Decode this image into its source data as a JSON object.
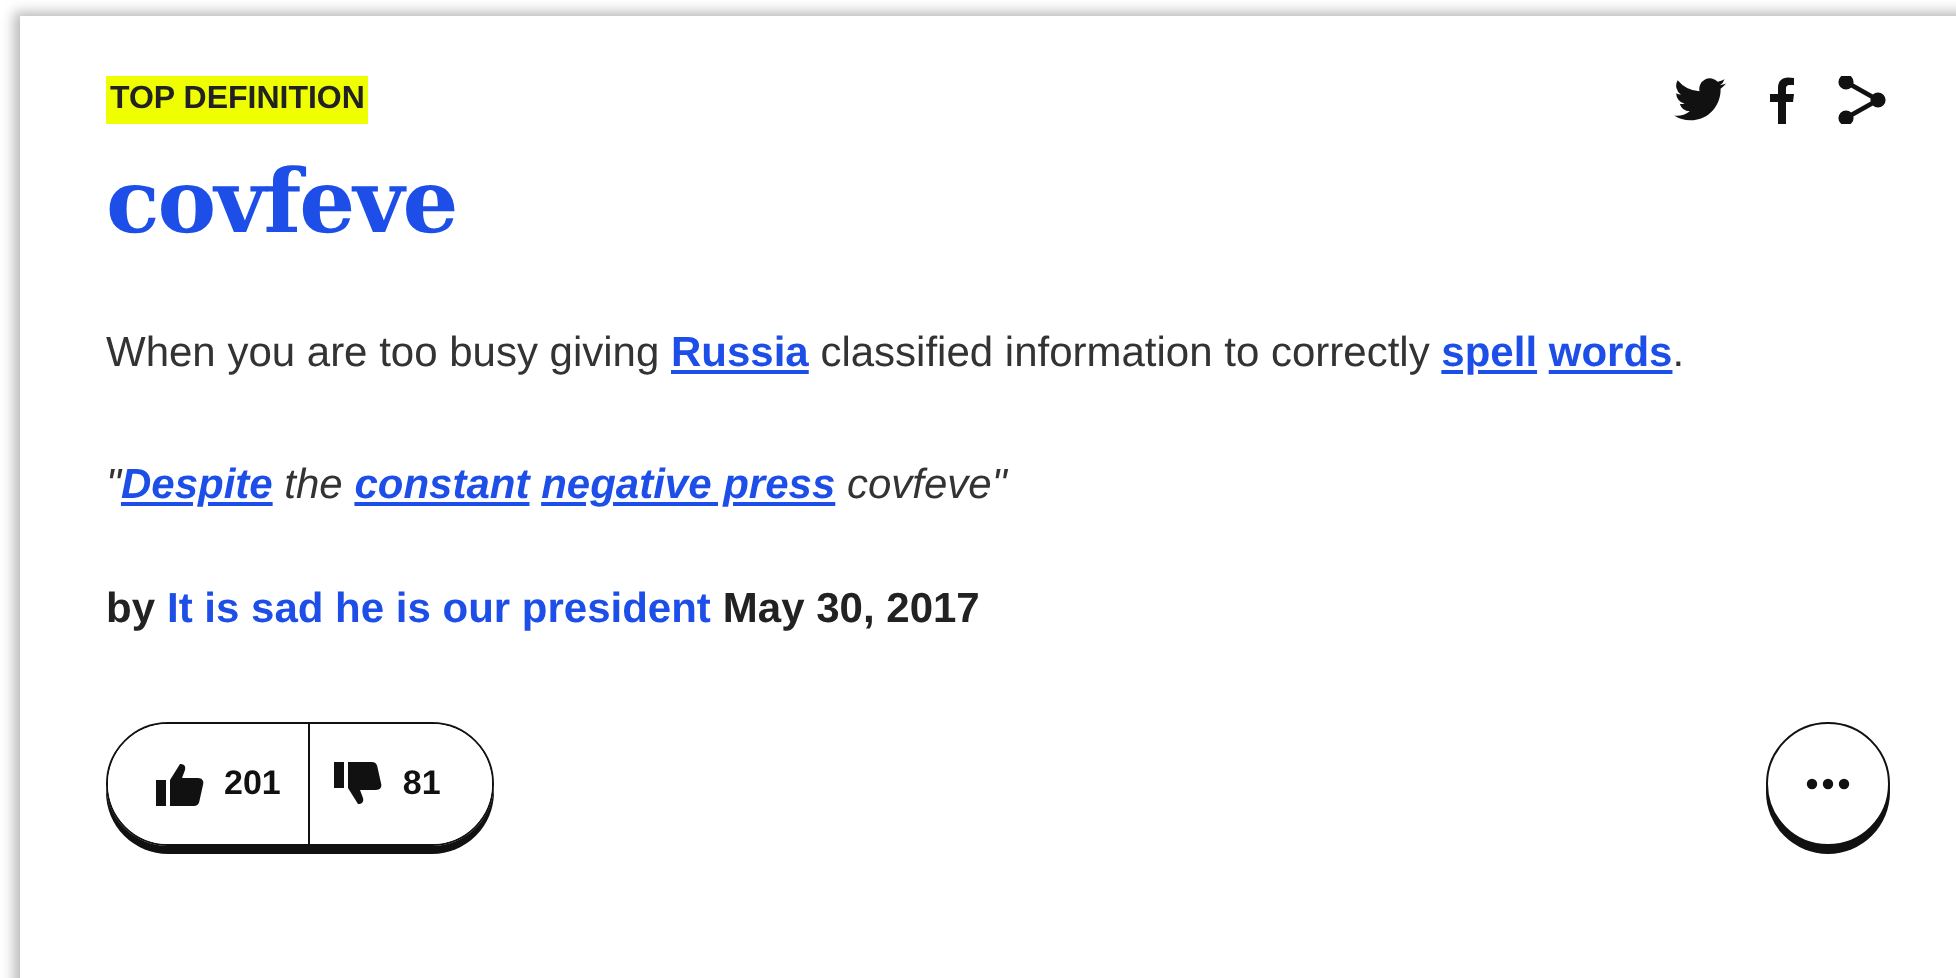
{
  "badge": "TOP DEFINITION",
  "share": [
    {
      "kind": "twitter"
    },
    {
      "kind": "facebook"
    },
    {
      "kind": "share"
    }
  ],
  "word": "covfeve",
  "meaning": [
    {
      "kind": "text",
      "text": "When you are too busy giving "
    },
    {
      "kind": "link",
      "text": "Russia"
    },
    {
      "kind": "text",
      "text": " classified information to correctly "
    },
    {
      "kind": "link",
      "text": "spell"
    },
    {
      "kind": "link",
      "text": "words"
    },
    {
      "kind": "text",
      "text": "."
    }
  ],
  "example": [
    {
      "kind": "text",
      "text": "\""
    },
    {
      "kind": "link",
      "text": "Despite"
    },
    {
      "kind": "text",
      "text": " the "
    },
    {
      "kind": "link",
      "text": "constant"
    },
    {
      "kind": "link",
      "text": "negative press"
    },
    {
      "kind": "text",
      "text": " covfeve\""
    }
  ],
  "byline": {
    "by": "by",
    "author": "It is sad he is our president",
    "date": "May 30, 2017"
  },
  "votes": {
    "up": "201",
    "down": "81"
  }
}
